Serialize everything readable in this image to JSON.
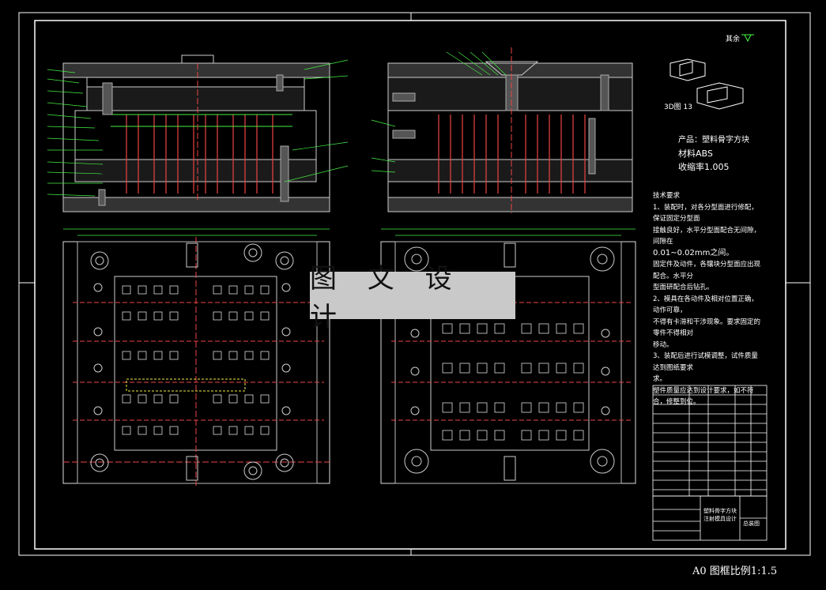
{
  "watermark": "图 文 设 计",
  "footer": "A0 图框比例1:1.5",
  "title_block_corner": "其余",
  "render_label": "3D图 13",
  "product": {
    "name": "产品：塑料骨字方块",
    "material": "材料ABS",
    "shrink": "收缩率1.005"
  },
  "tech_requirements": {
    "title": "技术要求",
    "lines": [
      "1、装配时，对各分型面进行修配，保证固定分型面",
      "接触良好，水平分型面配合无间隙，间隙在",
      "0.01~0.02mm之间。",
      "固定件及动件，各镶块分型面应出现配合。水平分",
      "型面研配合后钻孔。",
      "2、模具在各动件及相对位置正确，动作可靠，",
      "不得有卡滞和干涉现象。要求固定的零件不得相对",
      "移动。",
      "3、装配后进行试模调整，试件质量达到图纸要求",
      "求。",
      "塑件质量应达到设计要求，如不符合，修整到位。"
    ]
  },
  "title_block": {
    "part_name": "塑料骨字方块",
    "subtitle": "注射模具设计",
    "drawing_no": "总装图"
  }
}
